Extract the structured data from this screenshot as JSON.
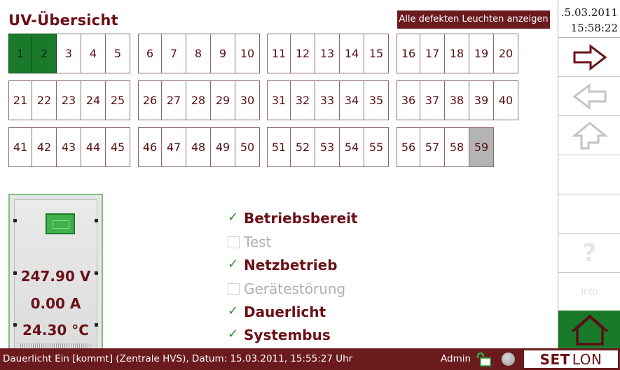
{
  "header": {
    "title": "UV-Übersicht",
    "show_defects_label": "Alle defekten Leuchten anzeigen"
  },
  "lamps": {
    "rows": [
      [
        [
          "1",
          "2",
          "3",
          "4",
          "5"
        ],
        [
          "6",
          "7",
          "8",
          "9",
          "10"
        ],
        [
          "11",
          "12",
          "13",
          "14",
          "15"
        ],
        [
          "16",
          "17",
          "18",
          "19",
          "20"
        ]
      ],
      [
        [
          "21",
          "22",
          "23",
          "24",
          "25"
        ],
        [
          "26",
          "27",
          "28",
          "29",
          "30"
        ],
        [
          "31",
          "32",
          "33",
          "34",
          "35"
        ],
        [
          "36",
          "37",
          "38",
          "39",
          "40"
        ]
      ],
      [
        [
          "41",
          "42",
          "43",
          "44",
          "45"
        ],
        [
          "46",
          "47",
          "48",
          "49",
          "50"
        ],
        [
          "51",
          "52",
          "53",
          "54",
          "55"
        ],
        [
          "56",
          "57",
          "58",
          "59"
        ]
      ]
    ],
    "active": [
      "1",
      "2"
    ],
    "selected": [
      "59"
    ]
  },
  "device": {
    "voltage": "247.90 V",
    "current": "0.00 A",
    "temperature": "24.30 °C"
  },
  "status_items": [
    {
      "label": "Betriebsbereit",
      "checked": true
    },
    {
      "label": "Test",
      "checked": false
    },
    {
      "label": "Netzbetrieb",
      "checked": true
    },
    {
      "label": "Gerätestörung",
      "checked": false
    },
    {
      "label": "Dauerlicht",
      "checked": true
    },
    {
      "label": "Systembus",
      "checked": true
    }
  ],
  "clock": {
    "date": ".5.03.2011",
    "time": "15:58:22"
  },
  "sidebar": {
    "help_label": "?",
    "info_label": "Info"
  },
  "statusbar": {
    "message": "Dauerlicht Ein [kommt] (Zentrale HVS), Datum: 15.03.2011, 15:55:27 Uhr",
    "user": "Admin",
    "logo_set": "SET",
    "logo_lon": "LON"
  },
  "colors": {
    "accent": "#6b1a1d",
    "active_lamp": "#1a7a2c",
    "selected_lamp": "#b4b4b4",
    "home_button": "#1a7a2c"
  }
}
